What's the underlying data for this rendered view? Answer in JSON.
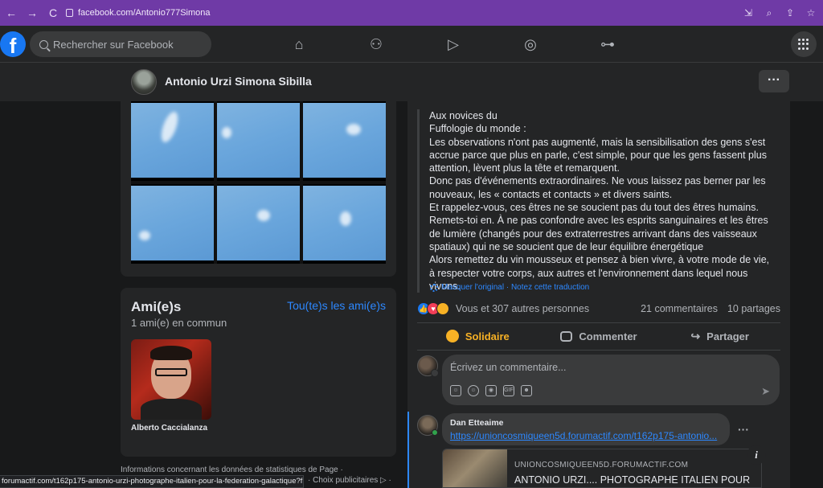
{
  "browser": {
    "url": "facebook.com/Antonio777Simona",
    "back": "←",
    "forward": "→",
    "reload": "C"
  },
  "topbar": {
    "logo": "f",
    "search_placeholder": "Rechercher sur Facebook"
  },
  "page": {
    "name": "Antonio Urzi Simona Sibilla",
    "more": "···"
  },
  "friends": {
    "title": "Ami(e)s",
    "see_all": "Tou(te)s les ami(e)s",
    "common": "1 ami(e) en commun",
    "items": [
      {
        "name": "Alberto Caccialanza"
      }
    ]
  },
  "footer": {
    "line1": "Informations concernant les données de statistiques de Page ·",
    "line2": "· Choix publicitaires ▷ ·"
  },
  "statusbar": {
    "url": "forumactif.com/t162p175-antonio-urzi-photographe-italien-pour-la-federation-galactique?fbcl..."
  },
  "post": {
    "lines": [
      "Aux novices du",
      "Fuffologie du monde :",
      "Les observations n'ont pas augmenté, mais la sensibilisation des gens s'est accrue parce que plus en parle, c'est simple, pour que les gens fassent plus attention, lèvent plus la tête et remarquent.",
      "Donc pas d'événements extraordinaires. Ne vous laissez pas berner par les nouveaux, les « contacts et contacts » et divers saints.",
      "Et rappelez-vous, ces êtres ne se soucient pas du tout des êtres humains. Remets-toi en. À ne pas confondre avec les esprits sanguinaires et les êtres de lumière (changés pour des extraterrestres arrivant dans des vaisseaux spatiaux) qui ne se soucient que de leur équilibre énergétique",
      "Alors remettez du vin mousseux et pensez à bien vivre, à votre mode de vie, à respecter votre corps, aux autres et l'environnement dans lequel nous vivons."
    ],
    "translation": "Masquer l'original · Notez cette traduction",
    "reactions_text": "Vous et 307 autres personnes",
    "comments_count": "21 commentaires",
    "shares_count": "10 partages",
    "actions": {
      "react": "Solidaire",
      "comment": "Commenter",
      "share": "Partager"
    },
    "comment_placeholder": "Écrivez un commentaire...",
    "comment": {
      "author": "Dan Etteaime",
      "link": "https://unioncosmiqueen5d.forumactif.com/t162p175-antonio..."
    },
    "link_preview": {
      "domain": "UNIONCOSMIQUEEN5D.FORUMACTIF.COM",
      "title": "ANTONIO URZI.... PHOTOGRAPHE ITALIEN POUR"
    }
  },
  "colors": {
    "accent": "#2d88ff",
    "brand": "#1877f2",
    "care": "#f7b125",
    "chrome": "#6f3aa6"
  }
}
